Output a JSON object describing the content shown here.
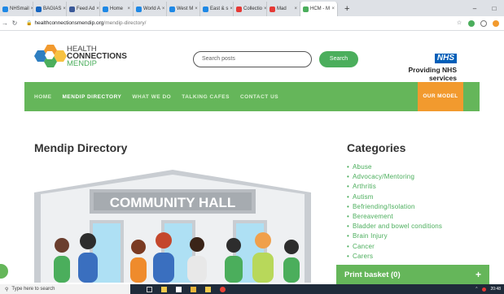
{
  "browser": {
    "tabs": [
      {
        "label": "NHSmail",
        "color": "#1e88e5"
      },
      {
        "label": "BAGIAS",
        "color": "#1565c0"
      },
      {
        "label": "Feed Ad",
        "color": "#3b5998"
      },
      {
        "label": "Home",
        "color": "#1e88e5"
      },
      {
        "label": "World A",
        "color": "#1e88e5"
      },
      {
        "label": "West M",
        "color": "#1e88e5"
      },
      {
        "label": "East & s",
        "color": "#1e88e5"
      },
      {
        "label": "Collectio",
        "color": "#e53935"
      },
      {
        "label": "Mad",
        "color": "#e53935"
      },
      {
        "label": "HCM - M",
        "color": "#4bae5c",
        "active": true
      }
    ],
    "new_tab": "+",
    "url_host": "healthconnectionsmendip.org",
    "url_path": "/mendip-directory/"
  },
  "header": {
    "logo_line1": "HEALTH",
    "logo_line2": "CONNECTIONS",
    "logo_line3": "MENDIP",
    "search_placeholder": "Search posts",
    "search_button": "Search",
    "nhs_badge": "NHS",
    "nhs_text": "Providing NHS services"
  },
  "nav": {
    "items": [
      "HOME",
      "MENDIP DIRECTORY",
      "WHAT WE DO",
      "TALKING CAFES",
      "CONTACT US"
    ],
    "model": "OUR MODEL"
  },
  "main": {
    "title": "Mendip Directory",
    "illustration_sign": "COMMUNITY HALL"
  },
  "sidebar": {
    "title": "Categories",
    "categories": [
      "Abuse",
      "Advocacy/Mentoring",
      "Arthritis",
      "Autism",
      "Befriending/Isolation",
      "Bereavement",
      "Bladder and bowel conditions",
      "Brain Injury",
      "Cancer",
      "Carers"
    ]
  },
  "basket": {
    "label": "Print basket (0)",
    "plus": "+"
  },
  "taskbar": {
    "search_placeholder": "Type here to search",
    "time": "20:48"
  },
  "colors": {
    "green": "#65b65a",
    "orange": "#f29a2e",
    "nhs_blue": "#005eb8"
  }
}
